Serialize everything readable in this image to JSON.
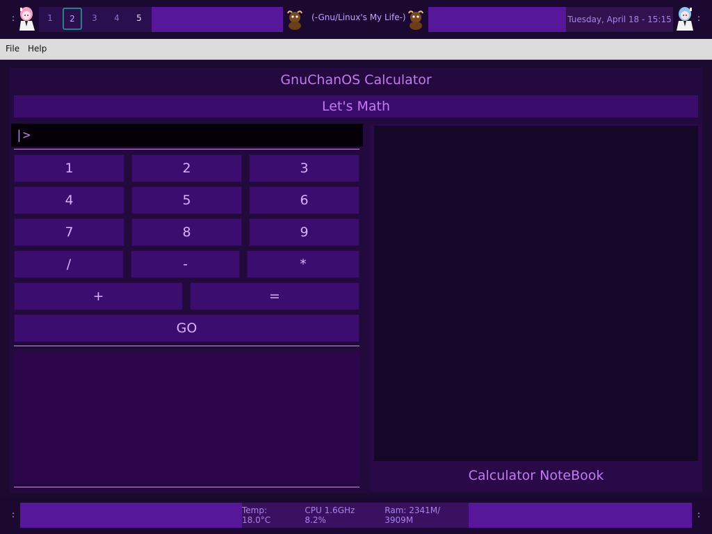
{
  "top_panel": {
    "left_dots": ":",
    "right_dots": ":",
    "workspaces": [
      {
        "label": "1",
        "state": "normal"
      },
      {
        "label": "2",
        "state": "active"
      },
      {
        "label": "3",
        "state": "normal"
      },
      {
        "label": "4",
        "state": "normal"
      },
      {
        "label": "5",
        "state": "occupied"
      }
    ],
    "window_title": "(-Gnu/Linux's My Life-)",
    "datetime": "Tuesday, April 18 - 15:15"
  },
  "menubar": {
    "items": [
      "File",
      "Help"
    ]
  },
  "calculator": {
    "title": "GnuChanOS Calculator",
    "subtitle": "Let's Math",
    "entry_value": "|>",
    "keys": {
      "row1": [
        "1",
        "2",
        "3"
      ],
      "row2": [
        "4",
        "5",
        "6"
      ],
      "row3": [
        "7",
        "8",
        "9"
      ],
      "row4": [
        "/",
        "-",
        "*"
      ],
      "row5": [
        "+",
        "="
      ],
      "go": "GO"
    },
    "notebook_label": "Calculator NoteBook"
  },
  "bottom_panel": {
    "left_dots": ":",
    "right_dots": ":",
    "temp": "Temp: 18.0°C",
    "cpu": "CPU 1.6GHz 8.2%",
    "ram": "Ram:  2341M/ 3909M"
  },
  "colors": {
    "accent": "#c27bf0",
    "button": "#3b0d6e",
    "panel_fill": "#56179b",
    "background": "#1d0a30"
  }
}
